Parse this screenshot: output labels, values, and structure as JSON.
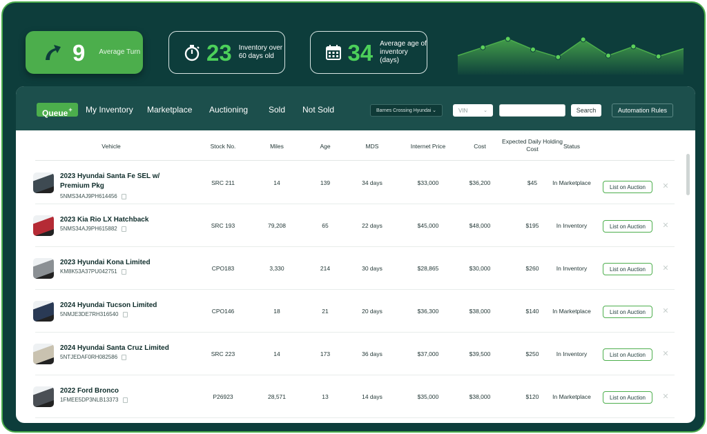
{
  "kpis": {
    "turn": {
      "value": "9",
      "label": "Average Turn",
      "icon": "trend-up-arrow-icon"
    },
    "over60": {
      "value": "23",
      "label": "Inventory over 60 days old",
      "icon": "stopwatch-icon"
    },
    "age": {
      "value": "34",
      "label": "Average age of inventory (days)",
      "icon": "calendar-icon"
    }
  },
  "sparkline": {
    "type": "area",
    "values": [
      0.35,
      0.62,
      0.9,
      0.55,
      0.3,
      0.88,
      0.35,
      0.65,
      0.32,
      0.58
    ]
  },
  "tabs": [
    {
      "label": "Queue",
      "badge": "+",
      "active": true
    },
    {
      "label": "My Inventory"
    },
    {
      "label": "Marketplace"
    },
    {
      "label": "Auctioning"
    },
    {
      "label": "Sold"
    },
    {
      "label": "Not Sold"
    }
  ],
  "filters": {
    "dealer": "Barnes Crossing Hyundai",
    "field": "VIN",
    "search_value": "",
    "search_label": "Search",
    "automation_label": "Automation Rules"
  },
  "columns": [
    "Vehicle",
    "Stock No.",
    "Miles",
    "Age",
    "MDS",
    "Internet Price",
    "Cost",
    "Expected Daily Holding Cost",
    "Status"
  ],
  "rows": [
    {
      "name": "2023 Hyundai Santa Fe SEL w/ Premium Pkg",
      "vin": "5NMS34AJ9PH614456",
      "stock": "SRC 211",
      "miles": "14",
      "age": "139",
      "mds": "34 days",
      "price": "$33,000",
      "cost": "$36,200",
      "hold": "$45",
      "status": "In Marketplace",
      "action": "List on Auction",
      "color": "#3e4a52"
    },
    {
      "name": "2023 Kia Rio LX Hatchback",
      "vin": "5NMS34AJ9PH615882",
      "stock": "SRC 193",
      "miles": "79,208",
      "age": "65",
      "mds": "22 days",
      "price": "$45,000",
      "cost": "$48,000",
      "hold": "$195",
      "status": "In Inventory",
      "action": "List on Auction",
      "color": "#b52b35"
    },
    {
      "name": "2023 Hyundai Kona Limited",
      "vin": "KM8K53A37PU042751",
      "stock": "CPO183",
      "miles": "3,330",
      "age": "214",
      "mds": "30 days",
      "price": "$28,865",
      "cost": "$30,000",
      "hold": "$260",
      "status": "In Inventory",
      "action": "List on Auction",
      "color": "#8b9094"
    },
    {
      "name": "2024 Hyundai Tucson Limited",
      "vin": "5NMJE3DE7RH316540",
      "stock": "CPO146",
      "miles": "18",
      "age": "21",
      "mds": "20 days",
      "price": "$36,300",
      "cost": "$38,000",
      "hold": "$140",
      "status": "In Marketplace",
      "action": "List on Auction",
      "color": "#2a3a55"
    },
    {
      "name": "2024 Hyundai Santa Cruz Limited",
      "vin": "5NTJEDAF0RH082586",
      "stock": "SRC 223",
      "miles": "14",
      "age": "173",
      "mds": "36 days",
      "price": "$37,000",
      "cost": "$39,500",
      "hold": "$250",
      "status": "In Inventory",
      "action": "List on Auction",
      "color": "#c9c2b0"
    },
    {
      "name": "2022 Ford Bronco",
      "vin": "1FMEE5DP3NLB13373",
      "stock": "P26923",
      "miles": "28,571",
      "age": "13",
      "mds": "14 days",
      "price": "$35,000",
      "cost": "$38,000",
      "hold": "$120",
      "status": "In Marketplace",
      "action": "List on Auction",
      "color": "#4a4f55"
    }
  ],
  "colors": {
    "brand_green": "#4cae4c",
    "dark_teal": "#0d3d3b",
    "toolbar_teal": "#1c4f4c"
  }
}
